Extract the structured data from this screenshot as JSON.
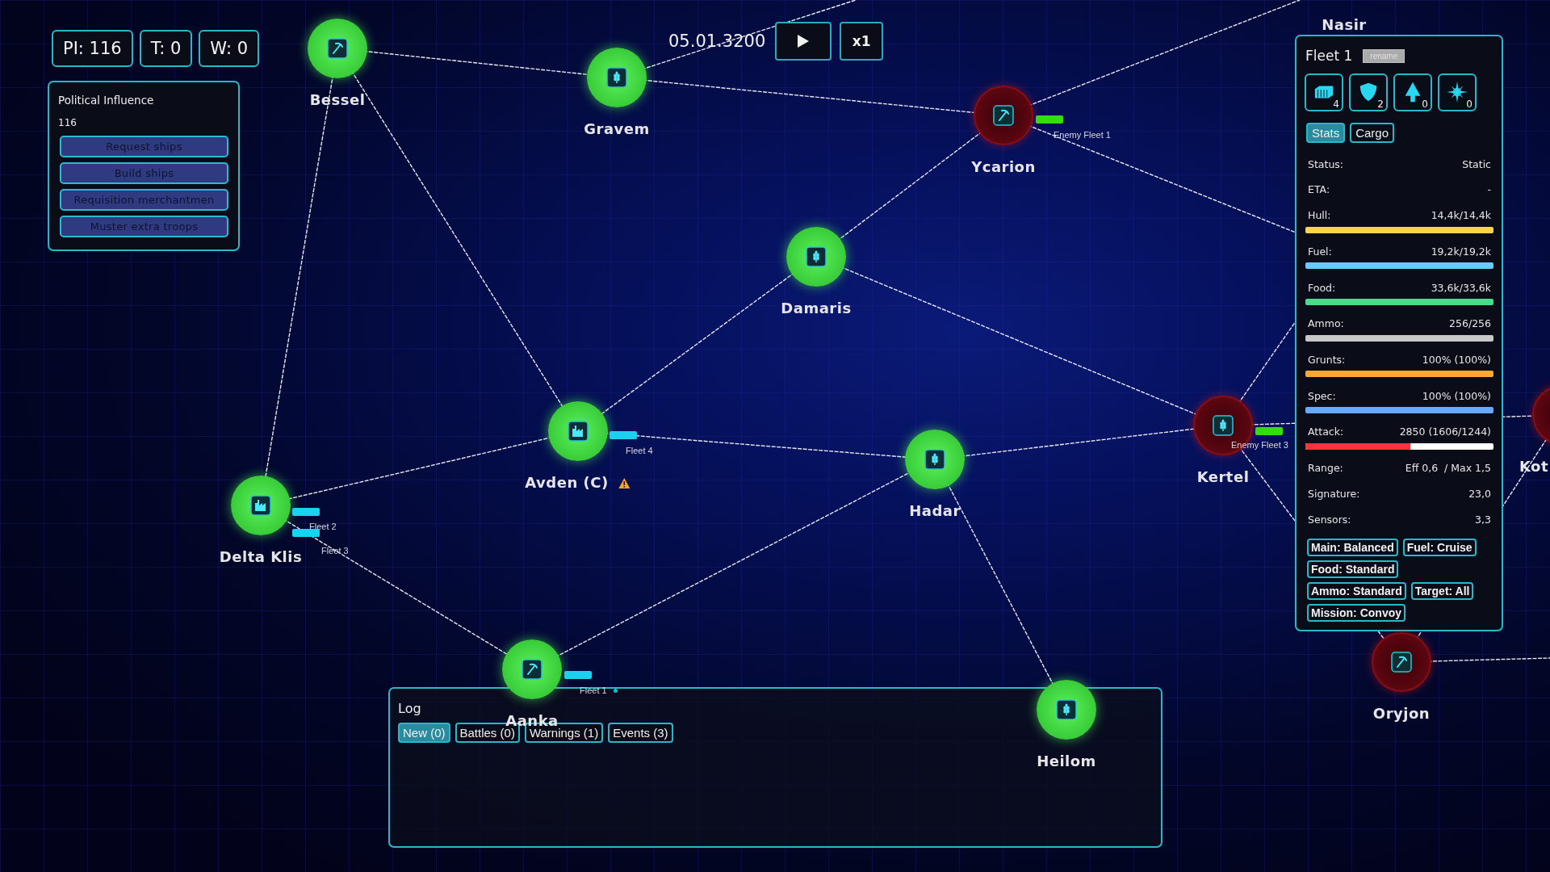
{
  "hud": [
    "PI: 116",
    "T: 0",
    "W: 0"
  ],
  "influence": {
    "title": "Political Influence",
    "value": "116",
    "actions": [
      "Request ships",
      "Build ships",
      "Requisition merchantmen",
      "Muster extra troops"
    ]
  },
  "time": {
    "date": "05.01.3200",
    "speed": "x1"
  },
  "nodes": [
    {
      "name": "Nasir"
    },
    {
      "name": "Bessel",
      "enemy": false,
      "kind": "mine",
      "warning": false
    },
    {
      "name": "Gravem",
      "enemy": false,
      "kind": "farm",
      "warning": false
    },
    {
      "name": "Ycarion",
      "enemy": true,
      "kind": "mine",
      "warning": false
    },
    {
      "name": "Damaris",
      "enemy": false,
      "kind": "farm",
      "warning": false
    },
    {
      "name": "Avden (C)",
      "enemy": false,
      "kind": "factory",
      "warning": true
    },
    {
      "name": "Hadar",
      "enemy": false,
      "kind": "farm",
      "warning": false
    },
    {
      "name": "Kertel",
      "enemy": true,
      "kind": "farm",
      "warning": false
    },
    {
      "name": "Kot",
      "enemy": true,
      "warning": false
    },
    {
      "name": "Delta Klis",
      "enemy": false,
      "kind": "factory",
      "warning": false
    },
    {
      "name": "Oryjon",
      "enemy": true,
      "kind": "mine",
      "warning": false
    },
    {
      "name": "Aanka",
      "enemy": false,
      "kind": "mine",
      "warning": false
    },
    {
      "name": "Heilom",
      "enemy": false,
      "kind": "farm",
      "warning": false
    }
  ],
  "fleets": [
    {
      "name": "Enemy Fleet 1",
      "enemy": true,
      "selected": false
    },
    {
      "name": "Fleet 4",
      "enemy": false,
      "selected": false
    },
    {
      "name": "Fleet 2",
      "enemy": false,
      "selected": false
    },
    {
      "name": "Fleet 3",
      "enemy": false,
      "selected": false
    },
    {
      "name": "Enemy Fleet 3",
      "enemy": true,
      "selected": false
    },
    {
      "name": "Fleet 1",
      "enemy": false,
      "selected": true
    }
  ],
  "fleet_panel": {
    "title": "Fleet 1",
    "rename": "rename",
    "ships": [
      {
        "kind": "cargo",
        "count": "4"
      },
      {
        "kind": "shield",
        "count": "2"
      },
      {
        "kind": "arrow",
        "count": "0"
      },
      {
        "kind": "star",
        "count": "0"
      }
    ],
    "tabs": [
      {
        "label": "Stats",
        "selected": true
      },
      {
        "label": "Cargo",
        "selected": false
      }
    ],
    "stats": [
      {
        "kind": "text",
        "label": "Status:",
        "value": "Static"
      },
      {
        "kind": "text",
        "label": "ETA:",
        "value": "-"
      },
      {
        "kind": "bar",
        "label": "Hull:",
        "value": "14,4k/14,4k",
        "level": 1,
        "color": "#ffd24a"
      },
      {
        "kind": "bar",
        "label": "Fuel:",
        "value": "19,2k/19,2k",
        "level": 1,
        "color": "#66ccff"
      },
      {
        "kind": "bar",
        "label": "Food:",
        "value": "33,6k/33,6k",
        "level": 1,
        "color": "#44dd88"
      },
      {
        "kind": "bar",
        "label": "Ammo:",
        "value": "256/256",
        "level": 1,
        "color": "#c8c8c8"
      },
      {
        "kind": "bar",
        "label": "Grunts:",
        "value": "100% (100%)",
        "level": 1,
        "color": "#ffa733"
      },
      {
        "kind": "bar",
        "label": "Spec:",
        "value": "100% (100%)",
        "level": 1,
        "color": "#66aaff"
      },
      {
        "kind": "bar",
        "label": "Attack:",
        "value": "2850 (1606/1244)",
        "level": 0.56,
        "color": "#ff3333"
      },
      {
        "kind": "text",
        "label": "Range:",
        "value": "Eff 0,6  / Max 1,5"
      },
      {
        "kind": "text",
        "label": "Signature:",
        "value": "23,0"
      },
      {
        "kind": "text",
        "label": "Sensors:",
        "value": "3,3"
      }
    ],
    "orders": [
      "Main: Balanced",
      "Fuel: Cruise",
      "Food: Standard",
      "Ammo: Standard",
      "Target: All",
      "Mission: Convoy"
    ]
  },
  "log": {
    "title": "Log",
    "tabs": [
      {
        "label": "New (0)",
        "selected": true
      },
      {
        "label": "Battles (0)",
        "selected": false
      },
      {
        "label": "Warnings (1)",
        "selected": false
      },
      {
        "label": "Events (3)",
        "selected": false
      }
    ]
  }
}
